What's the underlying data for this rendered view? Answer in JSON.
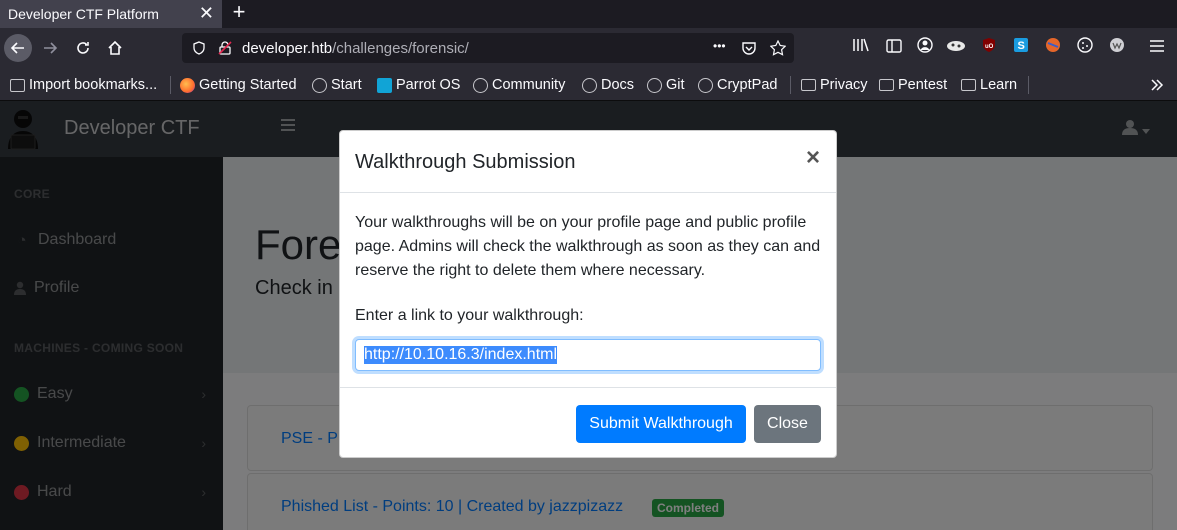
{
  "browser": {
    "tab_title": "Developer CTF Platform",
    "tab_close": "✕",
    "new_tab": "+",
    "url_host": "developer.htb",
    "url_path": "/challenges/forensic/",
    "page_actions": "•••"
  },
  "bookmarks": [
    {
      "label": "Import bookmarks..."
    },
    {
      "label": "Getting Started"
    },
    {
      "label": "Start"
    },
    {
      "label": "Parrot OS"
    },
    {
      "label": "Community"
    },
    {
      "label": "Docs"
    },
    {
      "label": "Git"
    },
    {
      "label": "CryptPad"
    },
    {
      "label": "Privacy"
    },
    {
      "label": "Pentest"
    },
    {
      "label": "Learn"
    }
  ],
  "site": {
    "brand": "Developer CTF",
    "sidebar": {
      "heading_core": "CORE",
      "dashboard": "Dashboard",
      "profile": "Profile",
      "heading_machines": "MACHINES - COMING SOON",
      "easy": "Easy",
      "intermediate": "Intermediate",
      "hard": "Hard"
    },
    "jumbotron": {
      "title": "Fore",
      "subtitle": "Check in"
    },
    "cards": [
      {
        "text": "PSE - P"
      },
      {
        "text": "Phished List - Points: 10 | Created by jazzpizazz",
        "badge": "Completed"
      }
    ]
  },
  "modal": {
    "title": "Walkthrough Submission",
    "close_glyph": "×",
    "body": "Your walkthroughs will be on your profile page and public profile page. Admins will check the walkthrough as soon as they can and reserve the right to delete them where necessary.",
    "label": "Enter a link to your walkthrough:",
    "input_value": "http://10.10.16.3/index.html",
    "submit_label": "Submit Walkthrough",
    "close_label": "Close"
  },
  "colors": {
    "primary": "#007bff",
    "secondary": "#6c757d",
    "success": "#28a745",
    "easy_dot": "#28a745",
    "intermediate_dot": "#ffc107",
    "hard_dot": "#dc3545"
  }
}
